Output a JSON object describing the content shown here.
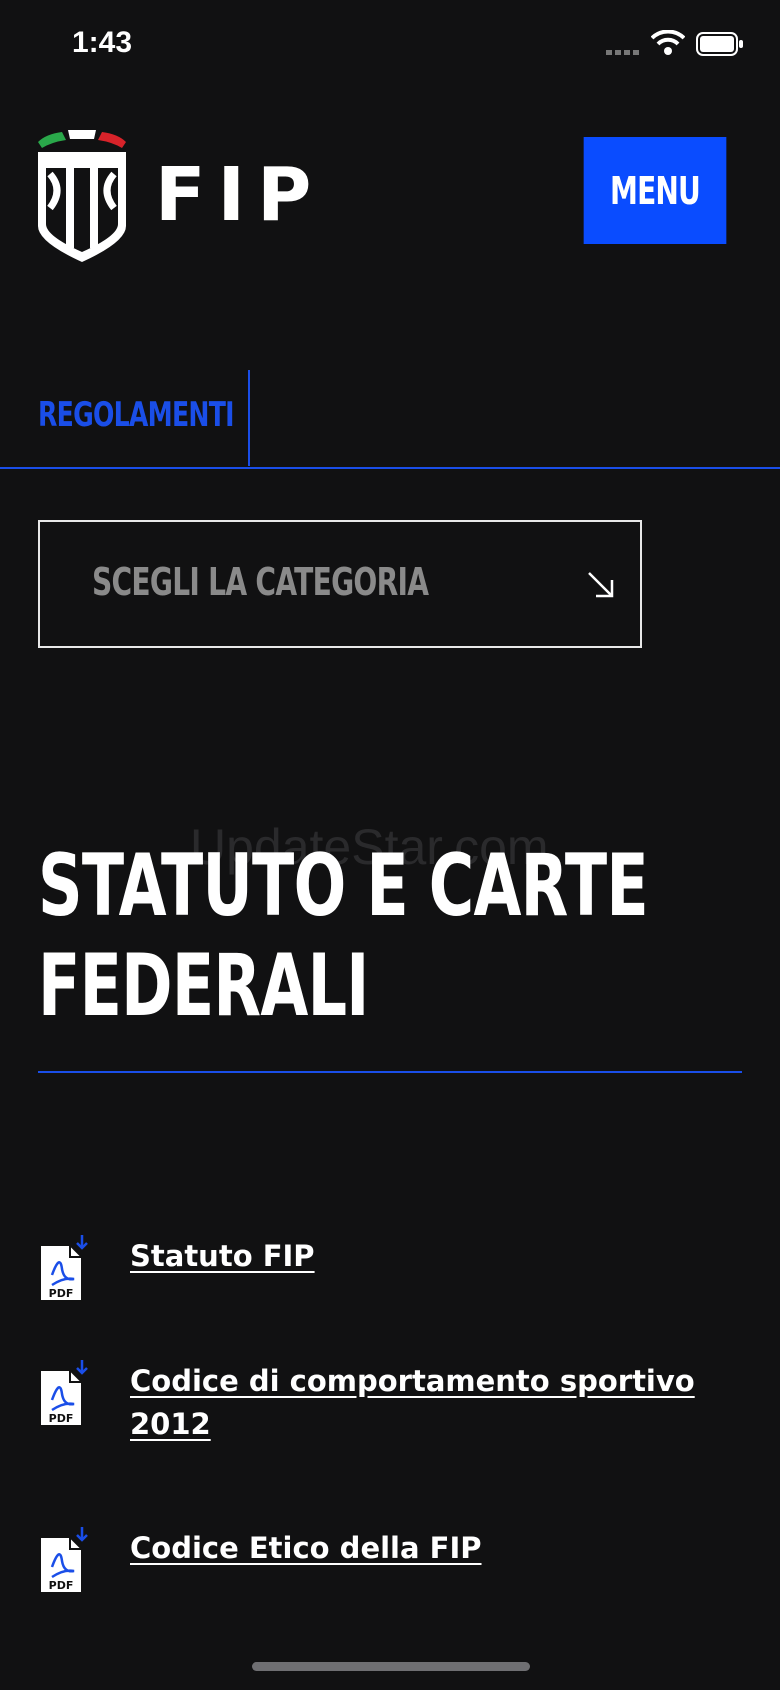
{
  "status_bar": {
    "time": "1:43"
  },
  "header": {
    "logo_text": "FIP",
    "menu_label": "MENU"
  },
  "tabs": [
    {
      "label": "REGOLAMENTI",
      "active": true
    }
  ],
  "category_select": {
    "placeholder": "SCEGLI LA CATEGORIA"
  },
  "watermark": "UpdateStar.com",
  "section": {
    "title_line1": "STATUTO E CARTE",
    "title_line2": "FEDERALI"
  },
  "documents": [
    {
      "label": "Statuto FIP",
      "icon": "pdf-download-icon",
      "badge": "PDF"
    },
    {
      "label": "Codice di comportamento sportivo 2012",
      "icon": "pdf-download-icon",
      "badge": "PDF"
    },
    {
      "label": "Codice Etico della FIP",
      "icon": "pdf-download-icon",
      "badge": "PDF"
    }
  ],
  "colors": {
    "background": "#111112",
    "accent": "#0a4cff",
    "tab_blue": "#1a4ee8"
  }
}
